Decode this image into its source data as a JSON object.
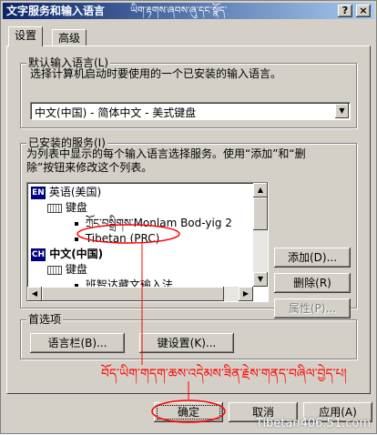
{
  "window": {
    "title": "文字服务和输入语言",
    "tibetan_title": "ཡིག་རྟགས་ཞབས་ཞུ་དང་སྣོད་",
    "help_btn": "?",
    "close_btn": "×"
  },
  "tabs": [
    {
      "label": "设置",
      "active": true
    },
    {
      "label": "高级",
      "active": false
    }
  ],
  "default_group": {
    "legend": "默认输入语言(L)",
    "description": "选择计算机启动时要使用的一个已安装的输入语言。",
    "selected": "中文(中国) - 简体中文 - 美式键盘"
  },
  "services_group": {
    "legend": "已安装的服务(I)",
    "description_line1": "为列表中显示的每个输入语言选择服务。使用“添加”和“删",
    "description_line2": "除”按钮来修改这个列表。",
    "tree": [
      {
        "type": "lang",
        "badge": "EN",
        "label": "英语(美国)"
      },
      {
        "type": "keyboard",
        "label": "键盘"
      },
      {
        "type": "item",
        "label": "ཀྲོང་བསྒྲིགས་Monlam Bod-yig 2"
      },
      {
        "type": "item",
        "label": "Tibetan (PRC)"
      },
      {
        "type": "lang",
        "badge": "CH",
        "label": "中文(中国)"
      },
      {
        "type": "keyboard",
        "label": "键盘"
      },
      {
        "type": "item",
        "label": "班智达藏文输入法"
      }
    ],
    "add_btn": "添加(D)...",
    "remove_btn": "删除(R)",
    "properties_btn": "属性(P)..."
  },
  "prefs_group": {
    "legend": "首选项",
    "langbar_btn": "语言栏(B)...",
    "keysettings_btn": "键设置(K)..."
  },
  "annotation": {
    "text": "བོད་ཡིག་གདག་ཆས་འདེམས་ཟིན་རྗེས་གནད་བཞིལ་བྱེད་པ།",
    "color": "#ff0000"
  },
  "footer": {
    "ok_btn": "确定",
    "cancel_btn": "取消",
    "apply_btn": "应用(A)"
  },
  "watermark": "Tibetan406.51.com"
}
